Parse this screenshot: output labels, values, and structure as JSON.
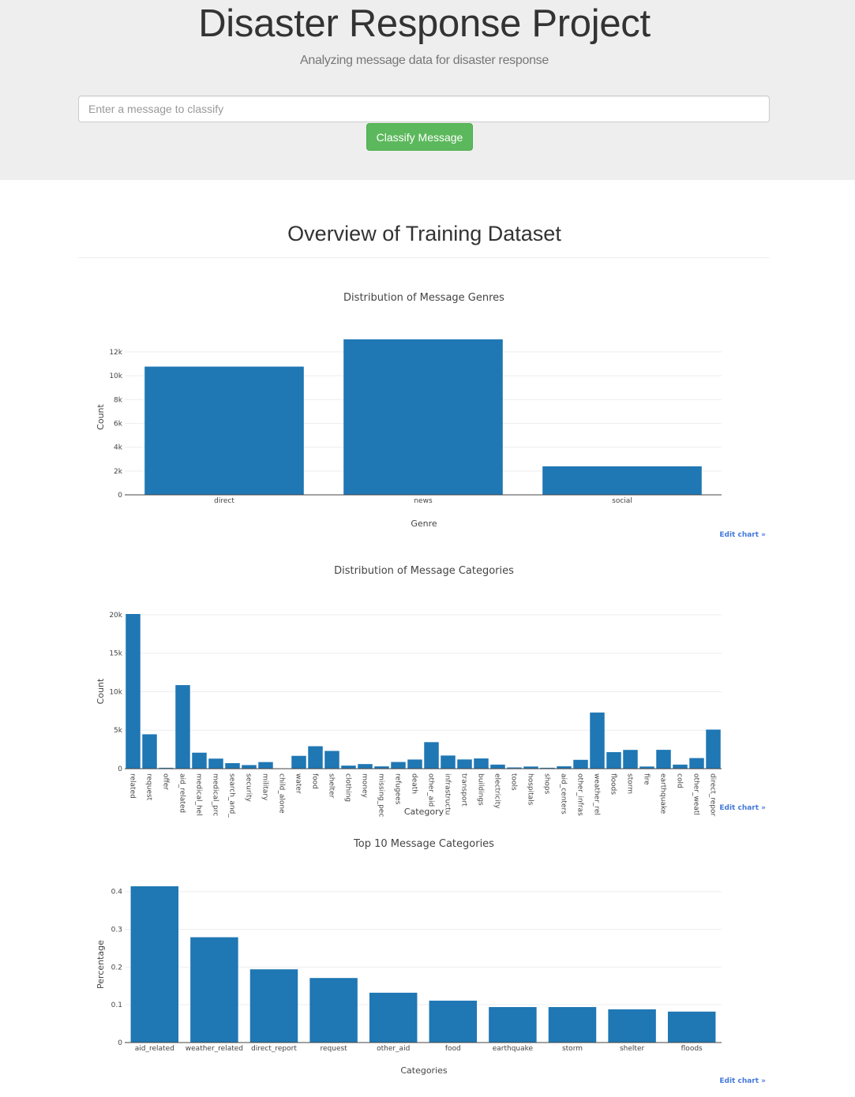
{
  "header": {
    "title": "Disaster Response Project",
    "subtitle": "Analyzing message data for disaster response",
    "input_placeholder": "Enter a message to classify",
    "button_label": "Classify Message"
  },
  "section_title": "Overview of Training Dataset",
  "edit_chart_label": "Edit chart »",
  "colors": {
    "bar": "#1f77b4",
    "button": "#5cb85c",
    "edit_link": "#447adb"
  },
  "chart_data": [
    {
      "type": "bar",
      "title": "Distribution of Message Genres",
      "xlabel": "Genre",
      "ylabel": "Count",
      "categories": [
        "direct",
        "news",
        "social"
      ],
      "values": [
        10766,
        13054,
        2396
      ],
      "ylim": [
        0,
        13054
      ],
      "yticks": [
        0,
        2000,
        4000,
        6000,
        8000,
        10000,
        12000
      ],
      "ytick_labels": [
        "0",
        "2k",
        "4k",
        "6k",
        "8k",
        "10k",
        "12k"
      ],
      "grid": true
    },
    {
      "type": "bar",
      "title": "Distribution of Message Categories",
      "xlabel": "Category",
      "ylabel": "Count",
      "categories": [
        "related",
        "request",
        "offer",
        "aid_related",
        "medical_hel",
        "medical_prc",
        "search_and_",
        "security",
        "military",
        "child_alone",
        "water",
        "food",
        "shelter",
        "clothing",
        "money",
        "missing_pec",
        "refugees",
        "death",
        "other_aid",
        "infrastructu",
        "transport",
        "buildings",
        "electricity",
        "tools",
        "hospitals",
        "shops",
        "aid_centers",
        "other_infras",
        "weather_rel",
        "floods",
        "storm",
        "fire",
        "earthquake",
        "cold",
        "other_weatl",
        "direct_repor"
      ],
      "values": [
        20100,
        4470,
        120,
        10860,
        2080,
        1310,
        720,
        470,
        860,
        0,
        1670,
        2920,
        2310,
        400,
        600,
        300,
        870,
        1190,
        3450,
        1710,
        1200,
        1330,
        530,
        160,
        280,
        120,
        310,
        1150,
        7300,
        2150,
        2440,
        280,
        2450,
        530,
        1380,
        5080
      ],
      "ylim": [
        0,
        20100
      ],
      "yticks": [
        0,
        5000,
        10000,
        15000,
        20000
      ],
      "ytick_labels": [
        "0",
        "5k",
        "10k",
        "15k",
        "20k"
      ],
      "grid": true
    },
    {
      "type": "bar",
      "title": "Top 10 Message Categories",
      "xlabel": "Categories",
      "ylabel": "Percentage",
      "categories": [
        "aid_related",
        "weather_related",
        "direct_report",
        "request",
        "other_aid",
        "food",
        "earthquake",
        "storm",
        "shelter",
        "floods"
      ],
      "values": [
        0.414,
        0.279,
        0.194,
        0.171,
        0.132,
        0.111,
        0.094,
        0.094,
        0.088,
        0.082
      ],
      "ylim": [
        0,
        0.414
      ],
      "yticks": [
        0,
        0.1,
        0.2,
        0.3,
        0.4
      ],
      "ytick_labels": [
        "0",
        "0.1",
        "0.2",
        "0.3",
        "0.4"
      ],
      "grid": true
    }
  ]
}
